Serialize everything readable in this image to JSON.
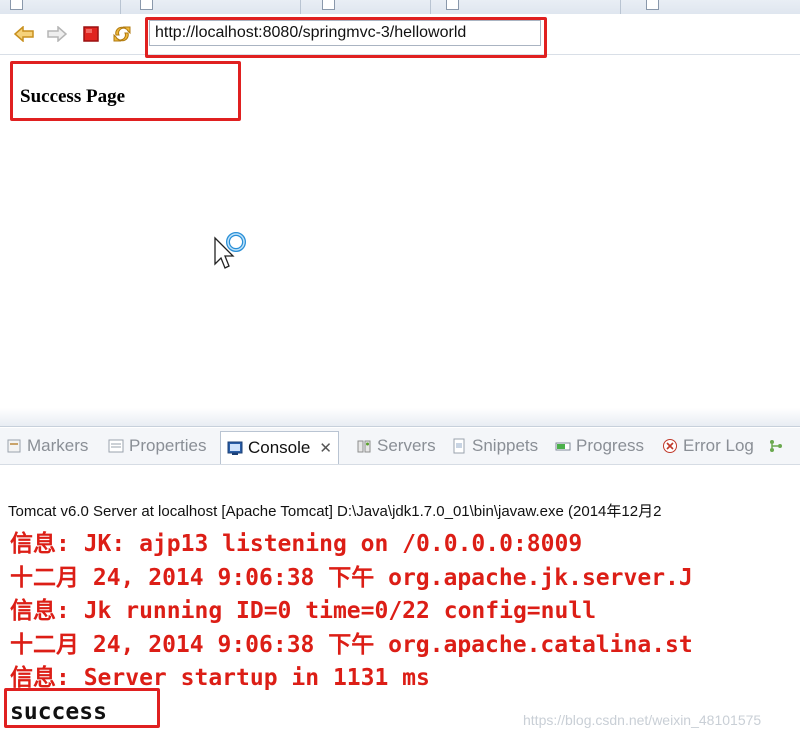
{
  "browser": {
    "url": "http://localhost:8080/springmvc-3/helloworld",
    "nav_icons": [
      "back-arrow-icon",
      "forward-arrow-icon",
      "stop-icon",
      "refresh-icon"
    ]
  },
  "page": {
    "title": "Success Page"
  },
  "views": {
    "tabs": [
      {
        "label": "Markers",
        "icon": "markers-icon",
        "active": false
      },
      {
        "label": "Properties",
        "icon": "properties-icon",
        "active": false
      },
      {
        "label": "Console",
        "icon": "console-icon",
        "active": true
      },
      {
        "label": "Servers",
        "icon": "servers-icon",
        "active": false
      },
      {
        "label": "Snippets",
        "icon": "snippets-icon",
        "active": false
      },
      {
        "label": "Progress",
        "icon": "progress-icon",
        "active": false
      },
      {
        "label": "Error Log",
        "icon": "error-log-icon",
        "active": false
      }
    ]
  },
  "console": {
    "header": "Tomcat v6.0 Server at localhost [Apache Tomcat] D:\\Java\\jdk1.7.0_01\\bin\\javaw.exe (2014年12月2",
    "lines": [
      "信息: JK: ajp13 listening on /0.0.0.0:8009",
      "十二月 24, 2014 9:06:38 下午 org.apache.jk.server.J",
      "信息: Jk running ID=0 time=0/22  config=null",
      "十二月 24, 2014 9:06:38 下午 org.apache.catalina.st",
      "信息: Server startup in 1131 ms",
      "success"
    ]
  },
  "watermark": "https://blog.csdn.net/weixin_48101575",
  "colors": {
    "highlight": "#e02020",
    "console_error": "#dc1e16"
  }
}
